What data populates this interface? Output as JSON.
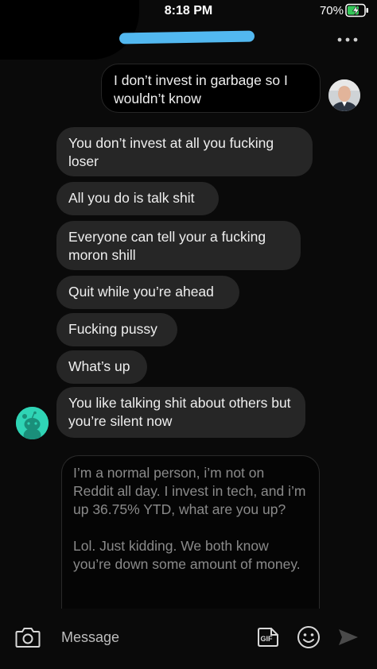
{
  "status_bar": {
    "time": "8:18 PM",
    "battery_percent": "70%",
    "battery_icon": "battery-charging-icon"
  },
  "header": {
    "more_icon": "more-horizontal-icon"
  },
  "messages": [
    {
      "direction": "outgoing",
      "text": "I don’t invest in garbage so I wouldn’t know"
    },
    {
      "direction": "incoming",
      "text": "You don’t invest at all you fucking loser"
    },
    {
      "direction": "incoming",
      "text": "All you do is talk shit"
    },
    {
      "direction": "incoming",
      "text": "Everyone can tell your a fucking moron shill"
    },
    {
      "direction": "incoming",
      "text": "Quit while you’re ahead"
    },
    {
      "direction": "incoming",
      "text": "Fucking pussy"
    },
    {
      "direction": "incoming",
      "text": "What’s up"
    },
    {
      "direction": "incoming",
      "text": "You like talking shit about others but you’re silent now"
    }
  ],
  "draft": {
    "paragraphs": [
      "I’m a normal person, i’m not on Reddit all day. I invest in tech, and i’m up 36.75% YTD, what are you up?",
      "Lol. Just kidding. We both know you’re down some amount of money."
    ]
  },
  "composer": {
    "placeholder": "Message",
    "gif_label": "GIF",
    "icons": [
      "camera-icon",
      "gif-icon",
      "emoji-icon",
      "send-icon"
    ]
  },
  "colors": {
    "background": "#0a0a0a",
    "incoming_bubble": "#262626",
    "redaction_marker": "#52b8f0",
    "battery_charging": "#34c759",
    "sender_avatar": "#2fd4b5"
  }
}
